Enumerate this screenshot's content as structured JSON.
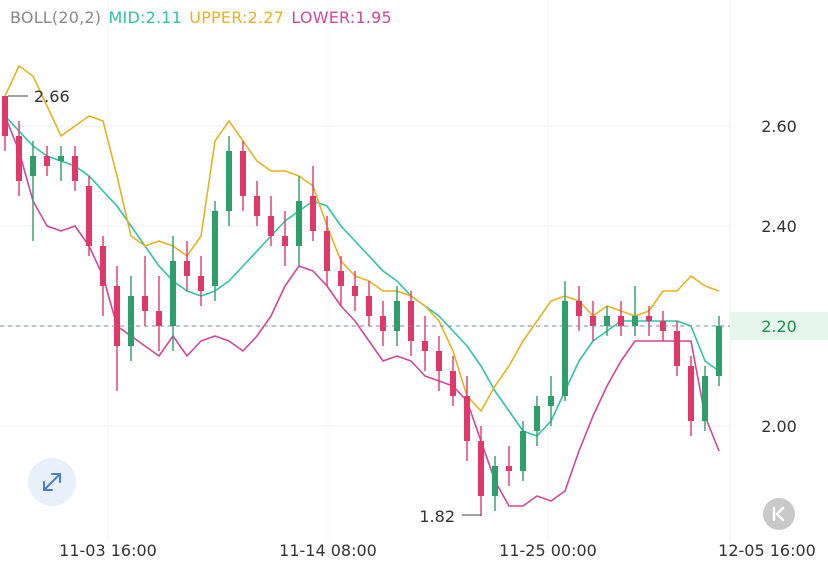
{
  "indicator": {
    "name": "BOLL(20,2)",
    "mid_label": "MID:2.11",
    "upper_label": "UPPER:2.27",
    "lower_label": "LOWER:1.95"
  },
  "colors": {
    "mid": "#2ec4a4",
    "upper": "#e6b422",
    "lower": "#d0489a",
    "up_candle": "#2e9e6a",
    "down_candle": "#e0386b",
    "current_price_line": "#7a8ba8",
    "current_price_bg": "#e6f6ec",
    "current_price_text": "#1f8f4e",
    "axis_text": "#333333"
  },
  "icons": {
    "expand": "expand-arrows-icon",
    "back": "skip-back-icon"
  },
  "chart_data": {
    "type": "candlestick",
    "y_axis": {
      "ticks": [
        2.0,
        2.2,
        2.4,
        2.6
      ],
      "range": [
        1.8,
        2.74
      ],
      "position": "right"
    },
    "x_axis": {
      "ticks": [
        "11-03 16:00",
        "11-14 08:00",
        "11-25 00:00",
        "12-05 16:00"
      ]
    },
    "current_price": 2.2,
    "high_marker": "2.66",
    "low_marker": "1.82",
    "grid": true,
    "series": [
      {
        "name": "MID",
        "values": [
          2.62,
          2.59,
          2.56,
          2.54,
          2.53,
          2.52,
          2.5,
          2.47,
          2.44,
          2.4,
          2.36,
          2.32,
          2.29,
          2.27,
          2.26,
          2.27,
          2.29,
          2.32,
          2.35,
          2.38,
          2.41,
          2.43,
          2.45,
          2.44,
          2.4,
          2.37,
          2.34,
          2.31,
          2.29,
          2.26,
          2.24,
          2.22,
          2.19,
          2.16,
          2.12,
          2.07,
          2.03,
          1.99,
          1.98,
          2.01,
          2.07,
          2.13,
          2.17,
          2.19,
          2.21,
          2.21,
          2.21,
          2.21,
          2.21,
          2.2,
          2.13,
          2.11
        ]
      },
      {
        "name": "UPPER",
        "values": [
          2.66,
          2.72,
          2.7,
          2.64,
          2.58,
          2.6,
          2.62,
          2.61,
          2.5,
          2.38,
          2.36,
          2.37,
          2.36,
          2.34,
          2.38,
          2.57,
          2.61,
          2.57,
          2.53,
          2.51,
          2.51,
          2.5,
          2.48,
          2.4,
          2.33,
          2.3,
          2.29,
          2.27,
          2.27,
          2.26,
          2.24,
          2.21,
          2.15,
          2.06,
          2.03,
          2.08,
          2.12,
          2.17,
          2.21,
          2.25,
          2.26,
          2.25,
          2.22,
          2.24,
          2.23,
          2.22,
          2.23,
          2.27,
          2.27,
          2.3,
          2.28,
          2.27
        ]
      },
      {
        "name": "LOWER",
        "values": [
          2.62,
          2.55,
          2.45,
          2.4,
          2.39,
          2.4,
          2.36,
          2.3,
          2.2,
          2.18,
          2.16,
          2.14,
          2.18,
          2.14,
          2.17,
          2.18,
          2.17,
          2.15,
          2.18,
          2.22,
          2.28,
          2.32,
          2.31,
          2.28,
          2.24,
          2.21,
          2.17,
          2.13,
          2.14,
          2.13,
          2.1,
          2.09,
          2.08,
          2.05,
          1.97,
          1.89,
          1.84,
          1.84,
          1.86,
          1.85,
          1.87,
          1.95,
          2.02,
          2.08,
          2.13,
          2.17,
          2.17,
          2.17,
          2.17,
          2.17,
          2.02,
          1.95
        ]
      },
      {
        "name": "OHLC",
        "values": [
          [
            2.66,
            2.66,
            2.55,
            2.58
          ],
          [
            2.58,
            2.61,
            2.46,
            2.49
          ],
          [
            2.5,
            2.57,
            2.37,
            2.54
          ],
          [
            2.54,
            2.56,
            2.5,
            2.52
          ],
          [
            2.53,
            2.56,
            2.49,
            2.54
          ],
          [
            2.54,
            2.56,
            2.47,
            2.49
          ],
          [
            2.48,
            2.5,
            2.34,
            2.36
          ],
          [
            2.36,
            2.38,
            2.22,
            2.28
          ],
          [
            2.28,
            2.32,
            2.07,
            2.16
          ],
          [
            2.16,
            2.3,
            2.13,
            2.26
          ],
          [
            2.26,
            2.34,
            2.2,
            2.23
          ],
          [
            2.23,
            2.3,
            2.15,
            2.2
          ],
          [
            2.2,
            2.38,
            2.15,
            2.33
          ],
          [
            2.33,
            2.37,
            2.27,
            2.3
          ],
          [
            2.3,
            2.34,
            2.24,
            2.27
          ],
          [
            2.28,
            2.45,
            2.25,
            2.43
          ],
          [
            2.43,
            2.58,
            2.4,
            2.55
          ],
          [
            2.55,
            2.57,
            2.43,
            2.46
          ],
          [
            2.46,
            2.49,
            2.4,
            2.42
          ],
          [
            2.42,
            2.46,
            2.36,
            2.38
          ],
          [
            2.38,
            2.43,
            2.32,
            2.36
          ],
          [
            2.36,
            2.5,
            2.32,
            2.45
          ],
          [
            2.46,
            2.52,
            2.37,
            2.39
          ],
          [
            2.39,
            2.42,
            2.28,
            2.31
          ],
          [
            2.31,
            2.34,
            2.24,
            2.28
          ],
          [
            2.28,
            2.31,
            2.23,
            2.26
          ],
          [
            2.26,
            2.29,
            2.2,
            2.22
          ],
          [
            2.22,
            2.25,
            2.16,
            2.19
          ],
          [
            2.19,
            2.28,
            2.16,
            2.25
          ],
          [
            2.25,
            2.27,
            2.14,
            2.17
          ],
          [
            2.17,
            2.22,
            2.11,
            2.15
          ],
          [
            2.15,
            2.18,
            2.07,
            2.11
          ],
          [
            2.11,
            2.14,
            2.04,
            2.06
          ],
          [
            2.06,
            2.1,
            1.93,
            1.97
          ],
          [
            1.97,
            2.0,
            1.82,
            1.86
          ],
          [
            1.86,
            1.94,
            1.83,
            1.92
          ],
          [
            1.92,
            1.96,
            1.88,
            1.91
          ],
          [
            1.91,
            2.01,
            1.89,
            1.99
          ],
          [
            1.99,
            2.06,
            1.96,
            2.04
          ],
          [
            2.04,
            2.1,
            2.0,
            2.06
          ],
          [
            2.06,
            2.29,
            2.05,
            2.25
          ],
          [
            2.25,
            2.28,
            2.19,
            2.22
          ],
          [
            2.22,
            2.25,
            2.17,
            2.2
          ],
          [
            2.2,
            2.24,
            2.18,
            2.22
          ],
          [
            2.22,
            2.25,
            2.18,
            2.2
          ],
          [
            2.2,
            2.28,
            2.18,
            2.22
          ],
          [
            2.22,
            2.24,
            2.18,
            2.21
          ],
          [
            2.21,
            2.23,
            2.17,
            2.19
          ],
          [
            2.19,
            2.21,
            2.1,
            2.12
          ],
          [
            2.12,
            2.14,
            1.98,
            2.01
          ],
          [
            2.01,
            2.12,
            1.99,
            2.1
          ],
          [
            2.1,
            2.22,
            2.08,
            2.2
          ]
        ]
      }
    ]
  }
}
